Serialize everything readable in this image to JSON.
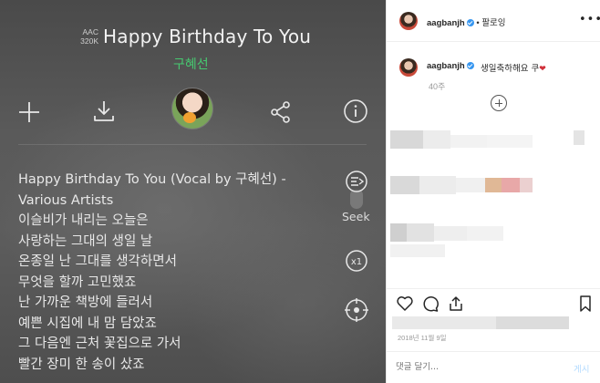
{
  "player": {
    "format_line1": "AAC",
    "format_line2": "320K",
    "song_title": "Happy Birthday To You",
    "artist": "구혜선",
    "seek_label": "Seek",
    "speed_label": "x1",
    "lyrics": [
      "Happy Birthday To You (Vocal by 구혜선) -",
      "Various Artists",
      "이슬비가 내리는 오늘은",
      "사랑하는 그대의 생일 날",
      "온종일 난 그대를 생각하면서",
      "무엇을 할까 고민했죠",
      "난 가까운 책방에 들러서",
      "예쁜 시집에 내 맘 담았죠",
      "그 다음엔 근처 꽃집으로 가서",
      "빨간 장미 한 송이 샀죠"
    ],
    "icons": {
      "add": "plus-icon",
      "download": "download-icon",
      "share": "share-icon",
      "info": "info-icon",
      "seek": "seek-icon",
      "target": "crosshair-icon"
    }
  },
  "instagram": {
    "username": "aagbanjh",
    "follow_label": "팔로잉",
    "separator": "•",
    "more_label": "•••",
    "caption_user": "aagbanjh",
    "caption_text": "생일축하해요 쿠",
    "caption_emoji": "❤",
    "age": "40주",
    "date": "2018년 11월 9일",
    "comment_placeholder": "댓글 달기...",
    "post_label": "게시",
    "accent_color": "#3897f0"
  }
}
